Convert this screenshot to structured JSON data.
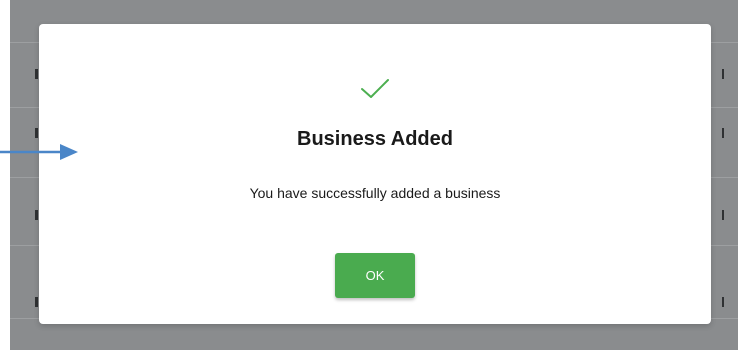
{
  "modal": {
    "title": "Business Added",
    "message": "You have successfully added a business",
    "ok_label": "OK",
    "icon": "checkmark-icon"
  },
  "colors": {
    "success_green": "#4aab4f",
    "check_green": "#4caf50",
    "overlay_gray": "#8a8c8e",
    "annotation_arrow_blue": "#4a86c8"
  }
}
